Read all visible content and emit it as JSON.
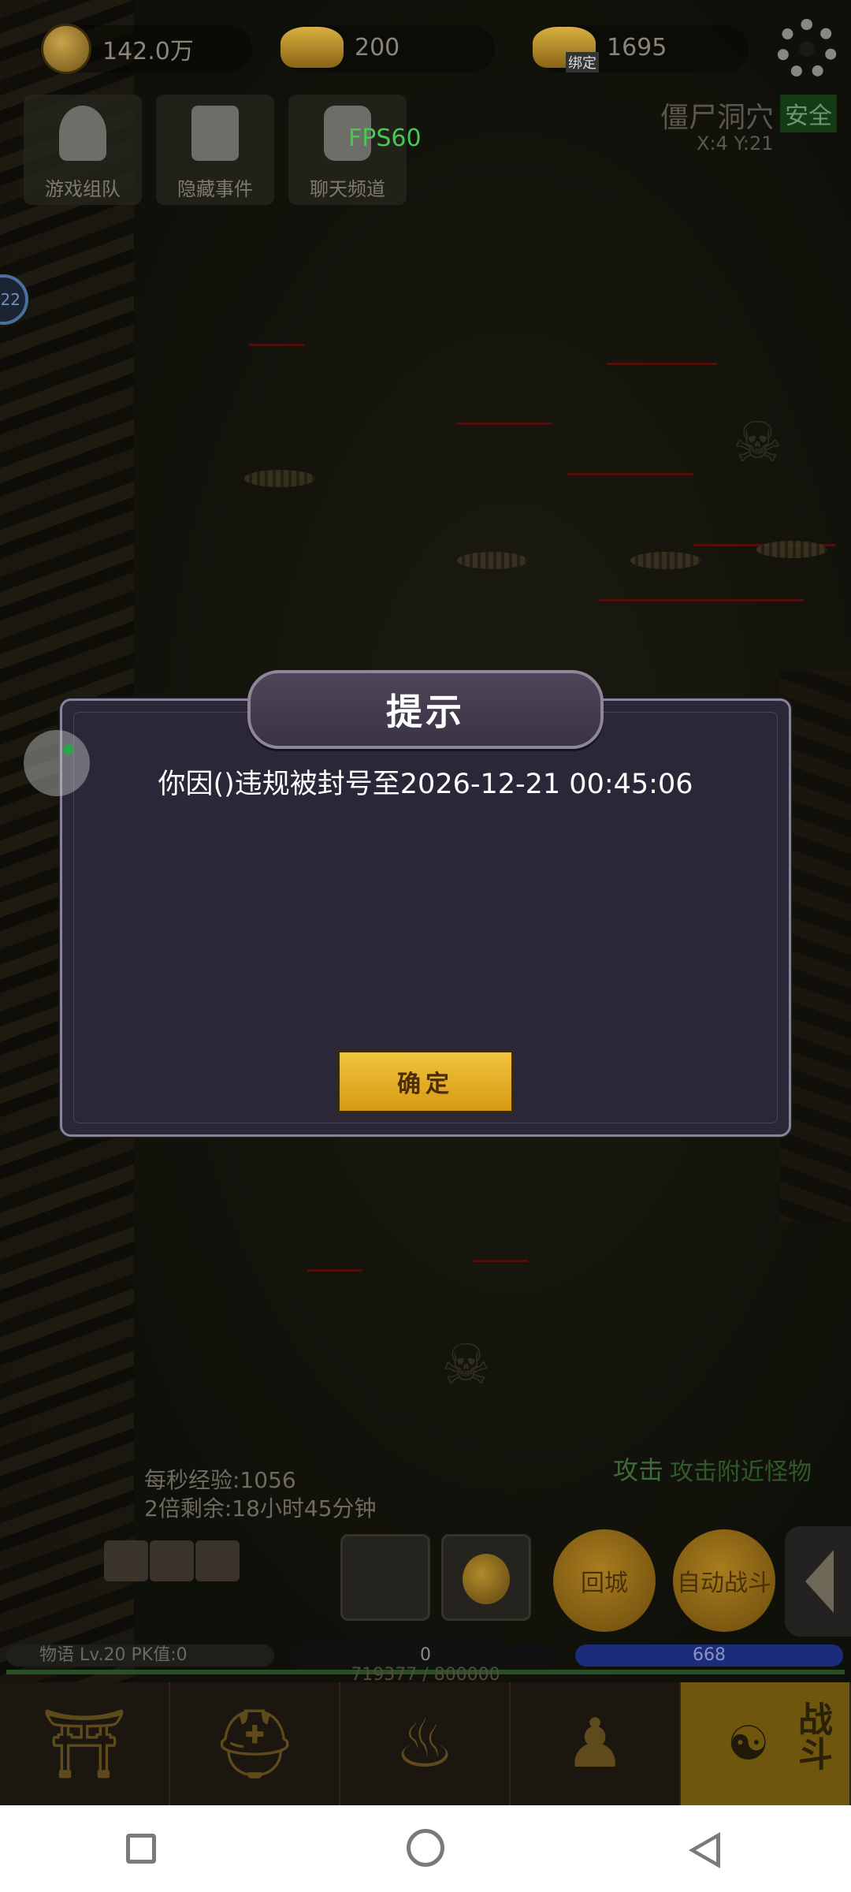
{
  "top_bar": {
    "copper": {
      "value": "142.0万",
      "icon": "copper-coin-icon"
    },
    "gold": {
      "value": "200",
      "icon": "gold-ingot-icon"
    },
    "bound_gold": {
      "value": "1695",
      "icon": "gold-ingot-icon",
      "tag": "绑定"
    },
    "settings_icon": "gear-icon"
  },
  "menu": [
    {
      "label": "游戏组队",
      "icon": "team-icon"
    },
    {
      "label": "隐藏事件",
      "icon": "scroll-icon"
    },
    {
      "label": "聊天频道",
      "icon": "chat-icon"
    }
  ],
  "fps": "FPS60",
  "map": {
    "name": "僵尸洞穴",
    "status": "安全",
    "coords": "X:4 Y:21"
  },
  "side_badge": "22",
  "dialog": {
    "title": "提示",
    "message": "你因()违规被封号至2026-12-21 00:45:06",
    "ok_label": "确定"
  },
  "hud": {
    "exp_rate": "每秒经验:1056",
    "double_remaining": "2倍剩余:18小时45分钟",
    "attack_label": "攻击",
    "attack_hint": "攻击附近怪物",
    "return_city": "回城",
    "auto_battle": "自动战斗",
    "player_info": "物语  Lv.20 PK值:0",
    "hp": "0",
    "mp": "668",
    "exp": "719377 / 800000"
  },
  "bottom_nav": [
    {
      "name": "city",
      "icon": "palace-icon"
    },
    {
      "name": "equipment",
      "icon": "helmet-icon"
    },
    {
      "name": "bag",
      "icon": "bag-icon"
    },
    {
      "name": "cultivate",
      "icon": "meditation-icon"
    },
    {
      "name": "battle",
      "icon": "taiji-icon",
      "label": "战斗",
      "active": true
    }
  ],
  "colors": {
    "accent_gold": "#f0c03a",
    "dialog_bg": "#2b2638",
    "fps_green": "#45c955",
    "mp_blue": "#1b2c7a"
  }
}
